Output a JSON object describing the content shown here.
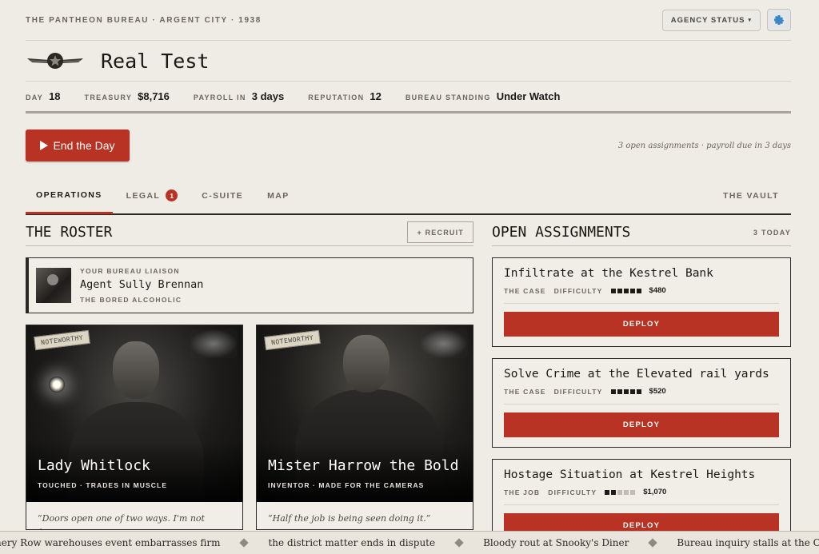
{
  "header": {
    "kicker": "THE PANTHEON BUREAU · ARGENT CITY · 1938",
    "agency_status": "AGENCY STATUS",
    "title": "Real Test"
  },
  "stats": [
    {
      "label": "DAY",
      "value": "18"
    },
    {
      "label": "TREASURY",
      "value": "$8,716"
    },
    {
      "label": "PAYROLL IN",
      "value": "3 days"
    },
    {
      "label": "REPUTATION",
      "value": "12"
    },
    {
      "label": "BUREAU STANDING",
      "value": "Under Watch"
    }
  ],
  "actions": {
    "end_day": "End the Day",
    "hint": "3 open assignments · payroll due in 3 days"
  },
  "tabs": {
    "operations": "OPERATIONS",
    "legal": "LEGAL",
    "legal_badge": "1",
    "csuite": "C-SUITE",
    "map": "MAP",
    "vault": "THE VAULT"
  },
  "roster": {
    "title": "THE ROSTER",
    "recruit": "+ RECRUIT",
    "liaison": {
      "kicker": "YOUR BUREAU LIAISON",
      "name": "Agent Sully Brennan",
      "trait": "THE BORED ALCOHOLIC"
    },
    "cards": [
      {
        "stamp": "NOTEWORTHY",
        "name": "Lady Whitlock",
        "tags": "TOUCHED · TRADES IN MUSCLE",
        "quote": "“Doors open one of two ways. I'm not fussy"
      },
      {
        "stamp": "NOTEWORTHY",
        "name": "Mister Harrow the Bold",
        "tags": "INVENTOR · MADE FOR THE CAMERAS",
        "quote": "“Half the job is being seen doing it.”"
      }
    ]
  },
  "assignments": {
    "title": "OPEN ASSIGNMENTS",
    "count": "3 TODAY",
    "items": [
      {
        "title": "Infiltrate at the Kestrel Bank",
        "type": "THE CASE",
        "difficulty_label": "DIFFICULTY",
        "difficulty": 5,
        "pay": "$480",
        "deploy": "DEPLOY"
      },
      {
        "title": "Solve Crime at the Elevated rail yards",
        "type": "THE CASE",
        "difficulty_label": "DIFFICULTY",
        "difficulty": 5,
        "pay": "$520",
        "deploy": "DEPLOY"
      },
      {
        "title": "Hostage Situation at Kestrel Heights",
        "type": "THE JOB",
        "difficulty_label": "DIFFICULTY",
        "difficulty": 2,
        "pay": "$1,070",
        "deploy": "DEPLOY"
      }
    ]
  },
  "ticker": [
    "nery Row warehouses event embarrasses firm",
    "the district matter ends in dispute",
    "Bloody rout at Snooky's Diner",
    "Bureau inquiry stalls at the Old I"
  ]
}
